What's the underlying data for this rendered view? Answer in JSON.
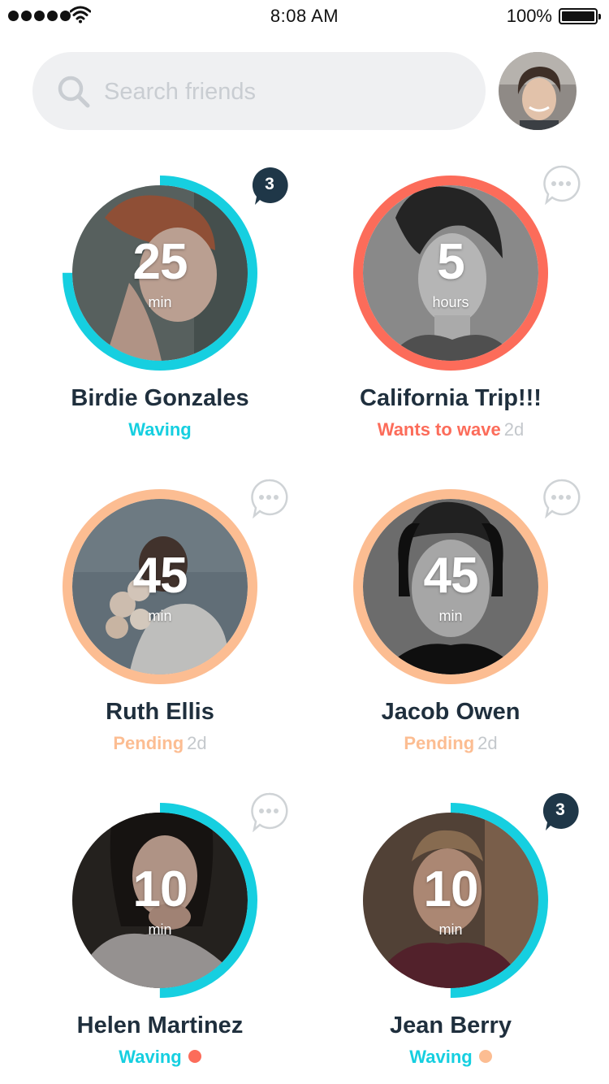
{
  "status_bar": {
    "time": "8:08 AM",
    "battery": "100%",
    "signal_icon": "signal-dots",
    "wifi_icon": "wifi-icon",
    "battery_icon": "battery-icon"
  },
  "search": {
    "placeholder": "Search friends",
    "icon": "search-icon"
  },
  "profile": {
    "icon": "avatar"
  },
  "colors": {
    "teal": "#16cfe0",
    "coral": "#fc6c5a",
    "peach": "#fcbd92",
    "navy": "#1f3748",
    "name": "#1f2f3d",
    "muted": "#c4c8cc"
  },
  "friends": [
    {
      "name": "Birdie Gonzales",
      "time_value": "25",
      "time_unit": "min",
      "status": "Waving",
      "status_age": "",
      "badge_type": "count",
      "badge_count": "3",
      "ring_progress": 0.75
    },
    {
      "name": "California Trip!!!",
      "time_value": "5",
      "time_unit": "hours",
      "status": "Wants to wave",
      "status_age": "2d",
      "badge_type": "chat",
      "badge_count": "",
      "ring_progress": 1.0
    },
    {
      "name": "Ruth Ellis",
      "time_value": "45",
      "time_unit": "min",
      "status": "Pending",
      "status_age": "2d",
      "badge_type": "chat",
      "badge_count": "",
      "ring_progress": 1.0
    },
    {
      "name": "Jacob Owen",
      "time_value": "45",
      "time_unit": "min",
      "status": "Pending",
      "status_age": "2d",
      "badge_type": "chat",
      "badge_count": "",
      "ring_progress": 1.0
    },
    {
      "name": "Helen Martinez",
      "time_value": "10",
      "time_unit": "min",
      "status": "Waving",
      "status_age": "",
      "badge_type": "chat",
      "badge_count": "",
      "ring_progress": 0.5
    },
    {
      "name": "Jean Berry",
      "time_value": "10",
      "time_unit": "min",
      "status": "Waving",
      "status_age": "",
      "badge_type": "count",
      "badge_count": "3",
      "ring_progress": 0.5
    }
  ]
}
